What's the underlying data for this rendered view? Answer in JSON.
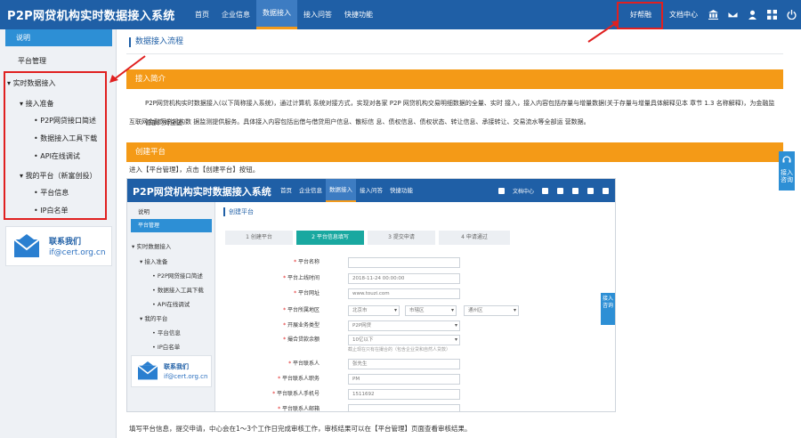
{
  "header": {
    "brand": "P2P网贷机构实时数据接入系统",
    "nav": [
      "首页",
      "企业信息",
      "数据接入",
      "接入问答",
      "快捷功能"
    ],
    "active_nav": "数据接入",
    "help_link": "好帮融",
    "docs_link": "文档中心",
    "icons": [
      "bank-icon",
      "mail-icon",
      "user-icon",
      "grid-icon",
      "power-icon"
    ]
  },
  "sidebar": {
    "intro_button": "说明",
    "platform_mgmt": "平台管理",
    "realtime": "实时数据接入",
    "prep": "接入准备",
    "prep_items": [
      "P2P网贷接口简述",
      "数据接入工具下载",
      "API在线调试"
    ],
    "my_platform": "我的平台（新富创投）",
    "my_items": [
      "平台信息",
      "IP白名单"
    ],
    "contact_title": "联系我们",
    "contact_email": "if@cert.org.cn"
  },
  "main": {
    "breadcrumb": "数据接入流程",
    "sec1_title": "接入简介",
    "sec1_line1": "P2P网贷机构实时数据接入(以下简称接入系统)，通过计算机 系统对接方式，实现对各家 P2P 网贷机构交易明细数据的全量、实时 接入，接入内容包括存量与增量数据(关于存量与增量具体解释见本 章节 1.3 名称解释)，为金融监管部门对全国",
    "sec1_line2": "互联网金融网贷机构数 据监测提供服务。具体接入内容包括出借与借贷用户信息、散标信 息、债权信息、债权状态、转让信息、承接转让、交易流水等全部运 营数据。",
    "sec2_title": "创建平台",
    "sec2_instr": "进入【平台管理】，点击【创建平台】按钮。",
    "footer_note": "填写平台信息，提交申请，中心会在1～3个工作日完成审核工作，审核结果可以在【平台管理】页面查看审核结果。",
    "float_tab": "接入咨询"
  },
  "embedded": {
    "brand": "P2P网贷机构实时数据接入系统",
    "nav": [
      "首页",
      "企业信息",
      "数据接入",
      "接入问答",
      "快捷功能"
    ],
    "active_nav": "数据接入",
    "docs_link": "文档中心",
    "side_intro": "说明",
    "side_platform": "平台管理",
    "side_realtime": "实时数据接入",
    "side_prep": "接入准备",
    "side_prep_items": [
      "P2P网贷接口简述",
      "数据接入工具下载",
      "API在线调试"
    ],
    "side_my": "我的平台",
    "side_my_items": [
      "平台信息",
      "IP白名单"
    ],
    "contact_title": "联系我们",
    "contact_email": "if@cert.org.cn",
    "page_title": "创建平台",
    "steps": [
      "1 创建平台",
      "2 平台信息填写",
      "3 提交申请",
      "4 申请通过"
    ],
    "active_step": 1,
    "float_tab": "接入咨询",
    "form": [
      {
        "label": "平台名称",
        "value": ""
      },
      {
        "label": "平台上线时间",
        "value": "2018-11-24 00:00:00"
      },
      {
        "label": "平台网址",
        "value": "www.touzi.com"
      },
      {
        "label": "平台所属地区",
        "value": "北京市",
        "value2": "市辖区",
        "value3": "通州区"
      },
      {
        "label": "开展业务类型",
        "value": "P2P网贷"
      },
      {
        "label": "撮合贷款余额",
        "value": "10亿以下",
        "hint": "截止现在只有在撮合的（包含企业贷和自然人贷款）"
      },
      {
        "label": "平台联系人",
        "value": "张先生"
      },
      {
        "label": "平台联系人职务",
        "value": "PM"
      },
      {
        "label": "平台联系人手机号",
        "value": "1511692"
      },
      {
        "label": "平台联系人邮箱",
        "value": ""
      }
    ]
  }
}
